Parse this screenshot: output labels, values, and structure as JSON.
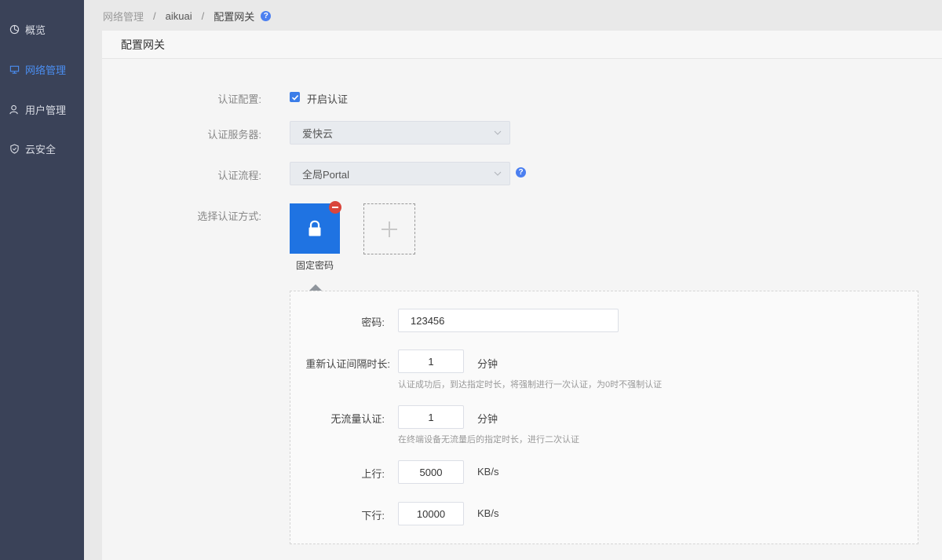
{
  "sidebar": {
    "items": [
      {
        "label": "概览",
        "icon": "pie-chart-icon"
      },
      {
        "label": "网络管理",
        "icon": "monitor-icon",
        "active": true
      },
      {
        "label": "用户管理",
        "icon": "user-icon"
      },
      {
        "label": "云安全",
        "icon": "shield-icon"
      }
    ]
  },
  "breadcrumb": {
    "items": [
      "网络管理",
      "aikuai",
      "配置网关"
    ],
    "separator": "/",
    "help": "?"
  },
  "panel": {
    "title": "配置网关"
  },
  "form": {
    "auth_config": {
      "label": "认证配置:",
      "checkbox_label": "开启认证",
      "checked": true
    },
    "auth_server": {
      "label": "认证服务器:",
      "value": "爱快云"
    },
    "auth_flow": {
      "label": "认证流程:",
      "value": "全局Portal",
      "help": "?"
    },
    "auth_method": {
      "label": "选择认证方式:",
      "selected": "固定密码",
      "icon": "lock-icon"
    }
  },
  "detail": {
    "password": {
      "label": "密码:",
      "value": "123456"
    },
    "reauth_interval": {
      "label": "重新认证间隔时长:",
      "value": "1",
      "unit": "分钟",
      "hint": "认证成功后，到达指定时长，将强制进行一次认证，为0时不强制认证"
    },
    "no_traffic": {
      "label": "无流量认证:",
      "value": "1",
      "unit": "分钟",
      "hint": "在终端设备无流量后的指定时长，进行二次认证"
    },
    "upload": {
      "label": "上行:",
      "value": "5000",
      "unit": "KB/s"
    },
    "download": {
      "label": "下行:",
      "value": "10000",
      "unit": "KB/s"
    }
  },
  "colors": {
    "sidebar_bg": "#3a4258",
    "accent": "#1f73e2",
    "active_nav": "#4b8ef1",
    "danger": "#d9453c"
  }
}
